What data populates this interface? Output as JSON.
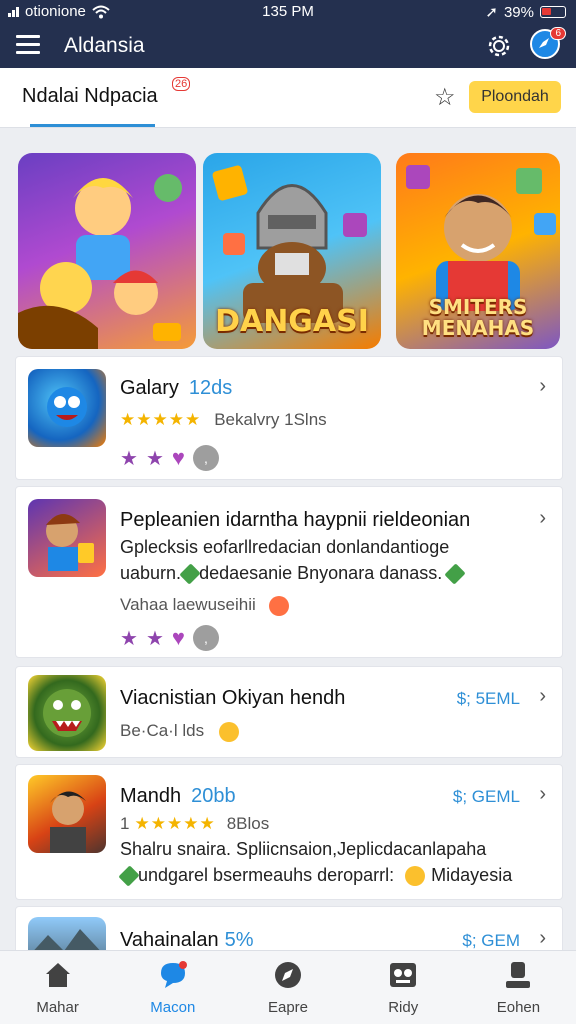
{
  "status_bar": {
    "carrier": "otionione",
    "time": "135 PM",
    "battery": "39%"
  },
  "app_bar": {
    "title": "Aldansia",
    "notification_badge": "6"
  },
  "tabs": {
    "active_label": "Ndalai Ndpacia",
    "badge": "26",
    "button_label": "Ploondah"
  },
  "banners": [
    {
      "text": ""
    },
    {
      "text": "DANGASI"
    },
    {
      "text": "SMITERS MENAHAS"
    }
  ],
  "list": [
    {
      "title": "Galary",
      "extra": "12ds",
      "rating_text": "Bekalvry 1Slns"
    },
    {
      "title": "Pepleanien idarntha haypnii rieldeonian",
      "line1": "Gplecksis eofarllredacian donlandantioge",
      "line2_a": "uaburn.",
      "line2_b": "dedaesanie Bnyonara danass.",
      "line3": "Vahaa laewuseihii"
    },
    {
      "title": "Viacnistian Okiyan hendh",
      "price": "$; 5EML",
      "line1": "Be·Ca·l lds"
    },
    {
      "title": "Mandh",
      "extra": "20bb",
      "price": "$; GEML",
      "rating_text": "8Blos",
      "line1": "Shalru snaira. Spliicnsaion,Jeplicdacanlapaha",
      "line2_a": "undgarel bsermeauhs deroparrl:",
      "line2_b": "Midayesia"
    },
    {
      "title": "Vahainalan",
      "extra": "5%",
      "price": "$; GEM"
    }
  ],
  "bottom_nav": [
    {
      "label": "Mahar",
      "icon": "home-icon"
    },
    {
      "label": "Macon",
      "icon": "chat-icon",
      "active": true
    },
    {
      "label": "Eapre",
      "icon": "explore-icon"
    },
    {
      "label": "Ridy",
      "icon": "gamepad-icon"
    },
    {
      "label": "Eohen",
      "icon": "profile-icon"
    }
  ],
  "colors": {
    "header": "#24304f",
    "accent": "#2e8fd6",
    "star": "#f4b400",
    "pill": "#ffd54a"
  }
}
